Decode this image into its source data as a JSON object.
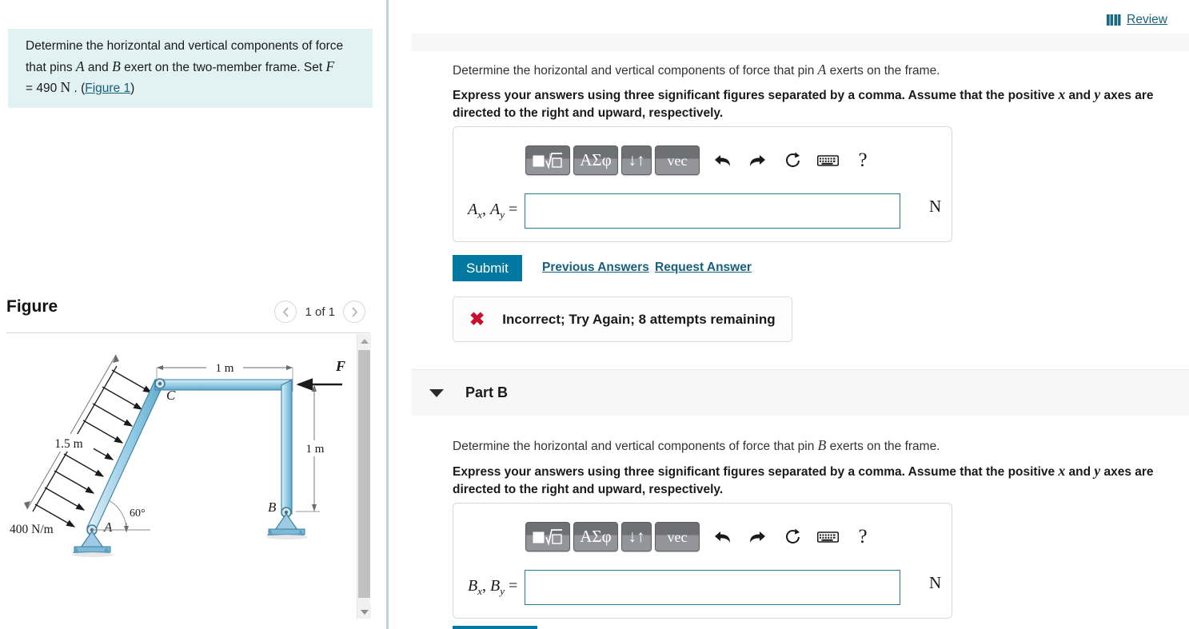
{
  "left": {
    "problem": {
      "line1_a": "Determine the horizontal and vertical components of force",
      "line2_a": "that pins ",
      "var_A": "A",
      "line2_b": " and ",
      "var_B": "B",
      "line2_c": " exert on the two-member frame. Set ",
      "var_F": "F",
      "line3_a": "= 490 ",
      "unit_N": "N",
      "line3_b": " . (",
      "figure_link": "Figure 1",
      "line3_c": ")"
    },
    "figure": {
      "title": "Figure",
      "counter": "1 of 1",
      "prev_icon": "chevron-left-icon",
      "next_icon": "chevron-right-icon",
      "diagram": {
        "dim_top": "1 m",
        "dim_right": "1 m",
        "dim_left": "1.5 m",
        "load_label": "400 N/m",
        "angle_label": "60°",
        "joint_A": "A",
        "joint_B": "B",
        "joint_C": "C",
        "force_F": "F"
      }
    }
  },
  "right": {
    "review": {
      "label": "Review",
      "icon": "book-icon"
    },
    "partA": {
      "prompt_pre": "Determine the horizontal and vertical components of force that pin ",
      "prompt_var": "A",
      "prompt_post": " exerts on the frame.",
      "instructions_pre": "Express your answers using three significant figures separated by a comma. Assume that the positive ",
      "instructions_x": "x",
      "instructions_mid": " and ",
      "instructions_y": "y",
      "instructions_post": " axes are directed to the right and upward, respectively.",
      "toolbar": {
        "sqrt_label": "▣√▯",
        "greek_label": "ΑΣφ",
        "arrows_label": "↓↑",
        "vec_label": "vec",
        "undo_icon": "undo-arrow-icon",
        "redo_icon": "redo-arrow-icon",
        "reset_icon": "reset-circle-icon",
        "keyboard_icon": "keyboard-icon",
        "help_label": "?"
      },
      "answer_label_main": "A",
      "answer_label_sub1": "x",
      "answer_label_sub2": "y",
      "answer_value": "",
      "answer_placeholder": "",
      "unit": "N",
      "submit_label": "Submit",
      "previous_answers_label": "Previous Answers",
      "request_answer_label": "Request Answer",
      "feedback_icon": "error-x-icon",
      "feedback_text": "Incorrect; Try Again; 8 attempts remaining"
    },
    "partB": {
      "header_title": "Part B",
      "caret_icon": "caret-down-icon",
      "prompt_pre": "Determine the horizontal and vertical components of force that pin ",
      "prompt_var": "B",
      "prompt_post": " exerts on the frame.",
      "instructions_pre": "Express your answers using three significant figures separated by a comma. Assume that the positive ",
      "instructions_x": "x",
      "instructions_mid": " and ",
      "instructions_y": "y",
      "instructions_post": " axes are directed to the right and upward, respectively.",
      "toolbar": {
        "sqrt_label": "▣√▯",
        "greek_label": "ΑΣφ",
        "arrows_label": "↓↑",
        "vec_label": "vec",
        "undo_icon": "undo-arrow-icon",
        "redo_icon": "redo-arrow-icon",
        "reset_icon": "reset-circle-icon",
        "keyboard_icon": "keyboard-icon",
        "help_label": "?"
      },
      "answer_label_main": "B",
      "answer_label_sub1": "x",
      "answer_label_sub2": "y",
      "answer_value": "",
      "answer_placeholder": "",
      "unit": "N"
    }
  },
  "colors": {
    "accent": "#0078a0",
    "link": "#17607d",
    "problem_bg": "#e2f1f1",
    "error": "#c8102e",
    "panel_gray": "#f7f7f7",
    "member_blue": "#a8d4e8"
  }
}
